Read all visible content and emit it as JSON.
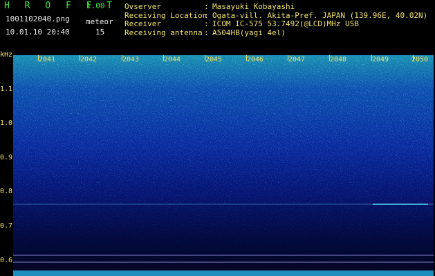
{
  "header": {
    "app_name": "H R O F F T",
    "version": "1.00",
    "filename": "1001102040.png",
    "datetime": "10.01.10 20:40",
    "detection_label": "meteor",
    "detection_count": "15",
    "info_rows": [
      {
        "label": "Ovserver",
        "sep": ":",
        "value": "Masayuki Kobayashi"
      },
      {
        "label": "Receiving Location",
        "sep": ":",
        "value": "Ogata-vill. Akita-Pref. JAPAN (139.96E, 40.02N)"
      },
      {
        "label": "Receiver",
        "sep": ":",
        "value": "ICOM IC-575 53.7492(@LCD)MHz USB"
      },
      {
        "label": "Receiving antenna",
        "sep": ":",
        "value": "A504HB(yagi 4el)"
      }
    ]
  },
  "axes": {
    "y_unit": "kHz",
    "y_ticks": [
      "1.1",
      "1.0",
      "0.9",
      "0.8",
      "0.7",
      "0.6"
    ],
    "x_ticks": [
      "2041",
      "2042",
      "2043",
      "2044",
      "2045",
      "2046",
      "2047",
      "2048",
      "2049",
      "2050"
    ]
  },
  "colors": {
    "label_yellow": "#f0e46a",
    "title_green": "#3ce83c",
    "spectrogram_top": "#0f6aa0",
    "spectrogram_bottom": "#000a2a"
  }
}
